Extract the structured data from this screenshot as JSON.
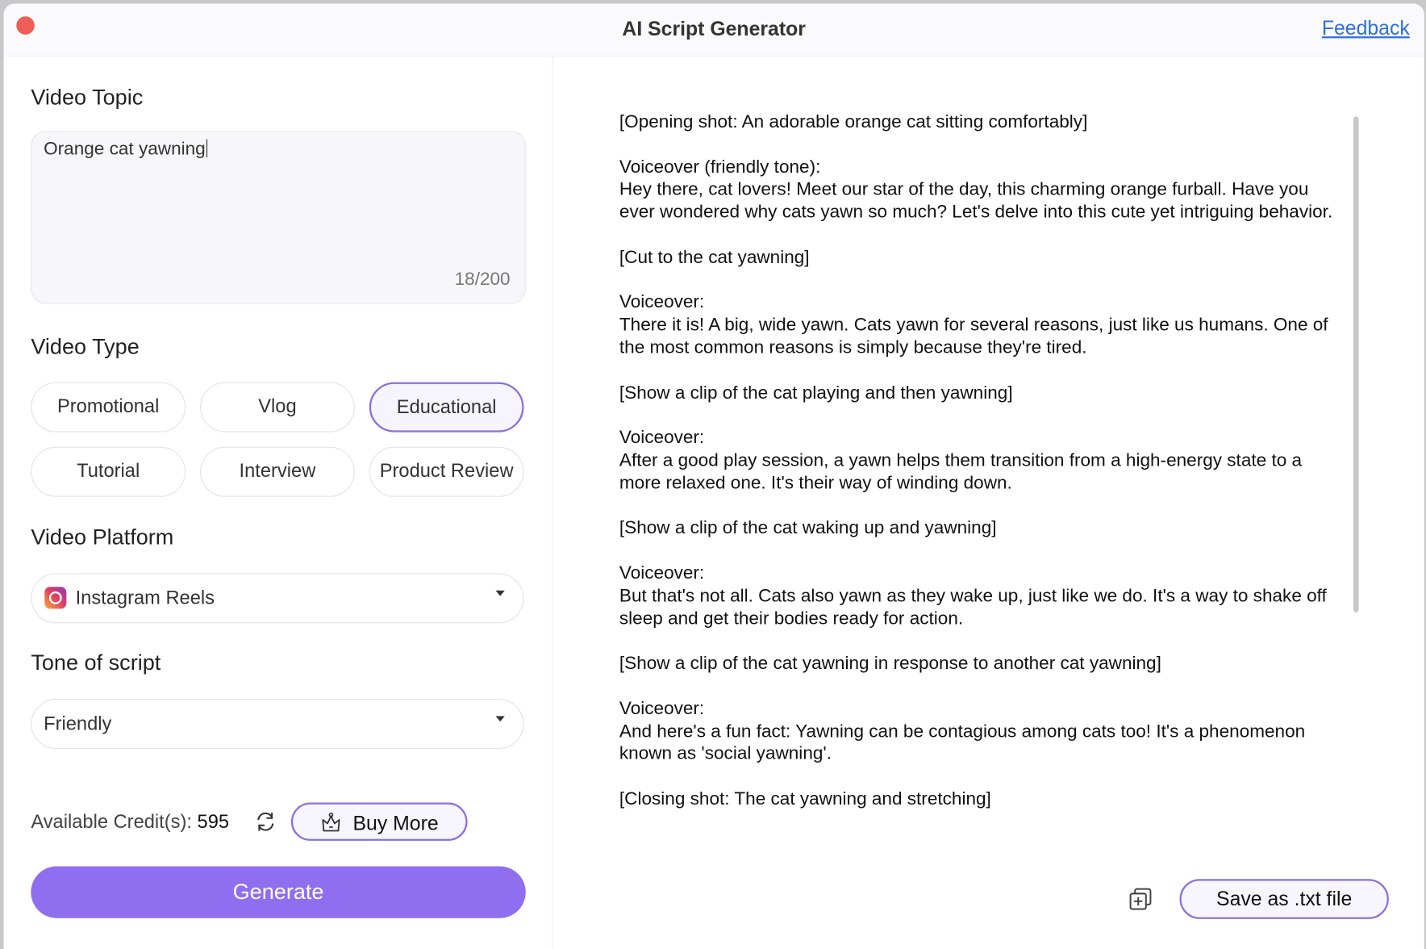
{
  "window": {
    "title": "AI Script Generator",
    "feedback_link": "Feedback"
  },
  "topic": {
    "label": "Video Topic",
    "value": "Orange cat yawning",
    "count": "18/200"
  },
  "video_type": {
    "label": "Video Type",
    "options": [
      "Promotional",
      "Vlog",
      "Educational",
      "Tutorial",
      "Interview",
      "Product Review"
    ],
    "selected": "Educational"
  },
  "platform": {
    "label": "Video Platform",
    "value": "Instagram Reels",
    "icon": "instagram-icon"
  },
  "tone": {
    "label": "Tone of script",
    "value": "Friendly"
  },
  "credits": {
    "label": "Available Credit(s):",
    "value": "595",
    "buy_label": "Buy More"
  },
  "generate_label": "Generate",
  "script": {
    "paragraphs": [
      "[Opening shot: An adorable orange cat sitting comfortably]",
      "Voiceover (friendly tone):\nHey there, cat lovers! Meet our star of the day, this charming orange furball. Have you ever wondered why cats yawn so much? Let's delve into this cute yet intriguing behavior.",
      "[Cut to the cat yawning]",
      "Voiceover:\nThere it is! A big, wide yawn. Cats yawn for several reasons, just like us humans. One of the most common reasons is simply because they're tired.",
      "[Show a clip of the cat playing and then yawning]",
      "Voiceover:\nAfter a good play session, a yawn helps them transition from a high-energy state to a more relaxed one. It's their way of winding down.",
      "[Show a clip of the cat waking up and yawning]",
      "Voiceover:\nBut that's not all. Cats also yawn as they wake up, just like we do. It's a way to shake off sleep and get their bodies ready for action.",
      "[Show a clip of the cat yawning in response to another cat yawning]",
      "Voiceover:\nAnd here's a fun fact: Yawning can be contagious among cats too! It's a phenomenon known as 'social yawning'.",
      "[Closing shot: The cat yawning and stretching]"
    ]
  },
  "save_label": "Save as .txt file",
  "colors": {
    "accent": "#8f6fef",
    "link": "#2f6fe0",
    "close": "#ee5e55"
  }
}
